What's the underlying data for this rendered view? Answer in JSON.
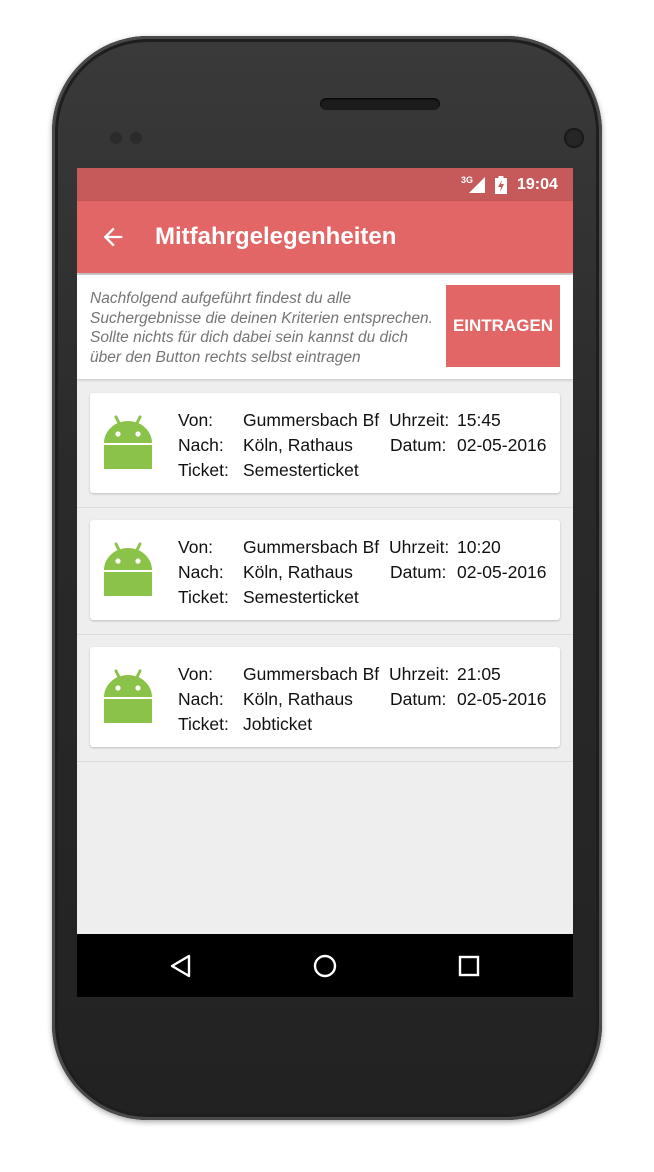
{
  "status": {
    "network": "3G",
    "time": "19:04"
  },
  "appbar": {
    "title": "Mitfahrgelegenheiten"
  },
  "info": {
    "lines": [
      "Nachfolgend aufgeführt findest du alle",
      "Suchergebnisse die deinen Kriterien entsprechen.",
      "Sollte nichts für dich dabei sein kannst du dich",
      "über den Button rechts selbst eintragen"
    ],
    "button_label": "EINTRAGEN"
  },
  "labels": {
    "from": "Von:",
    "to": "Nach:",
    "ticket": "Ticket:",
    "time": "Uhrzeit:",
    "date": "Datum:"
  },
  "rides": [
    {
      "from": "Gummersbach Bf",
      "to": "Köln, Rathaus",
      "ticket": "Semesterticket",
      "time": "15:45",
      "date": "02-05-2016"
    },
    {
      "from": "Gummersbach Bf",
      "to": "Köln, Rathaus",
      "ticket": "Semesterticket",
      "time": "10:20",
      "date": "02-05-2016"
    },
    {
      "from": "Gummersbach Bf",
      "to": "Köln, Rathaus",
      "ticket": "Jobticket",
      "time": "21:05",
      "date": "02-05-2016"
    }
  ],
  "colors": {
    "appbar": "#e26666",
    "statusbar": "#c65a5a",
    "android_green": "#8bc34a"
  },
  "icons": [
    "back-arrow-icon",
    "android-icon",
    "nav-back-icon",
    "nav-home-icon",
    "nav-recents-icon"
  ]
}
